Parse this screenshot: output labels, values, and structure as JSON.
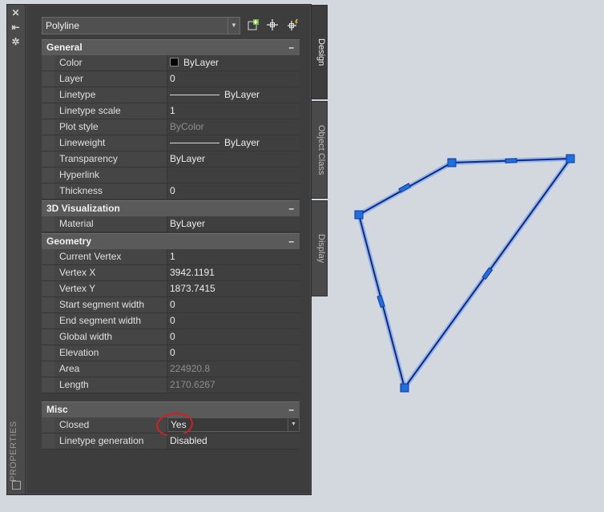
{
  "palette": {
    "title": "PROPERTIES",
    "close_icon": "close-icon",
    "autohide_icon": "autohide-icon",
    "settings_icon": "settings-icon"
  },
  "toolbar": {
    "selected_object": "Polyline",
    "buttons": [
      "toggle-pickadd-icon",
      "select-objects-icon",
      "quick-select-icon"
    ]
  },
  "tabs": [
    "Design",
    "Object Class",
    "Display"
  ],
  "categories": {
    "general": {
      "title": "General",
      "rows": {
        "color": {
          "label": "Color",
          "value": "ByLayer"
        },
        "layer": {
          "label": "Layer",
          "value": "0"
        },
        "linetype": {
          "label": "Linetype",
          "value": "ByLayer"
        },
        "linetype_scale": {
          "label": "Linetype scale",
          "value": "1"
        },
        "plot_style": {
          "label": "Plot style",
          "value": "ByColor"
        },
        "lineweight": {
          "label": "Lineweight",
          "value": "ByLayer"
        },
        "transparency": {
          "label": "Transparency",
          "value": "ByLayer"
        },
        "hyperlink": {
          "label": "Hyperlink",
          "value": ""
        },
        "thickness": {
          "label": "Thickness",
          "value": "0"
        }
      }
    },
    "visualization": {
      "title": "3D Visualization",
      "rows": {
        "material": {
          "label": "Material",
          "value": "ByLayer"
        }
      }
    },
    "geometry": {
      "title": "Geometry",
      "rows": {
        "current_vertex": {
          "label": "Current Vertex",
          "value": "1"
        },
        "vertex_x": {
          "label": "Vertex X",
          "value": "3942.1191"
        },
        "vertex_y": {
          "label": "Vertex Y",
          "value": "1873.7415"
        },
        "start_width": {
          "label": "Start segment width",
          "value": "0"
        },
        "end_width": {
          "label": "End segment width",
          "value": "0"
        },
        "global_width": {
          "label": "Global width",
          "value": "0"
        },
        "elevation": {
          "label": "Elevation",
          "value": "0"
        },
        "area": {
          "label": "Area",
          "value": "224920.8"
        },
        "length": {
          "label": "Length",
          "value": "2170.6267"
        }
      }
    },
    "misc": {
      "title": "Misc",
      "rows": {
        "closed": {
          "label": "Closed",
          "value": "Yes"
        },
        "linetype_generation": {
          "label": "Linetype generation",
          "value": "Disabled"
        }
      }
    }
  },
  "colors": {
    "polyline": "#0b2a8a",
    "selection_glow": "#7fa6e8",
    "grip": "#1f6fe0",
    "annotation": "#d42020"
  }
}
